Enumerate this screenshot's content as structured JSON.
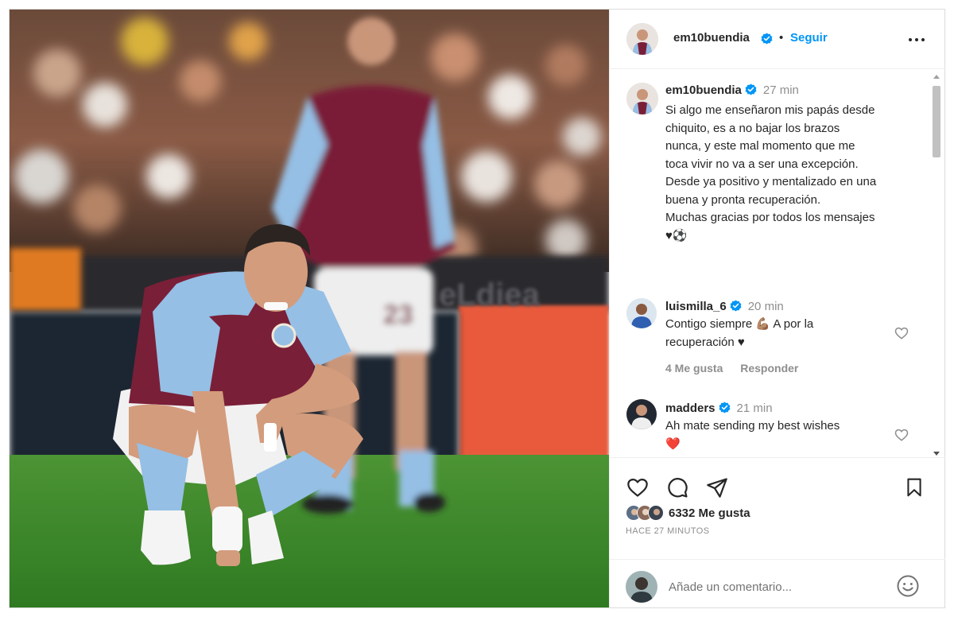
{
  "post": {
    "author": "em10buendia",
    "dot": "•",
    "follow_label": "Seguir",
    "more_icon": "more-horizontal-icon"
  },
  "caption": {
    "author": "em10buendia",
    "time": "27 min",
    "lines": [
      "Si algo me enseñaron mis papás desde",
      "chiquito, es a no bajar los brazos",
      "nunca, y este mal momento que me",
      "toca vivir no va a ser una excepción.",
      "Desde ya positivo y mentalizado en una",
      "buena y pronta recuperación.",
      "Muchas gracias por todos los mensajes",
      "♥⚽"
    ]
  },
  "comments": [
    {
      "user": "luismilla_6",
      "time": "20 min",
      "lines": [
        "Contigo siempre 💪🏽 A por la",
        "recuperación ♥"
      ],
      "likes": "4 Me gusta",
      "reply": "Responder"
    },
    {
      "user": "madders",
      "time": "21 min",
      "lines": [
        "Ah mate sending my best wishes",
        "❤️"
      ]
    }
  ],
  "footer": {
    "likes": "6332 Me gusta",
    "ago": "HACE 27 MINUTOS",
    "comment_placeholder": "Añade un comentario..."
  },
  "photo": {
    "shirt_number": "23"
  },
  "colors": {
    "accent": "#0095f6",
    "verified": "#0095f6",
    "heart_red": "#ed4956",
    "claret": "#7a1f38",
    "sky_blue": "#95bfe5",
    "pitch_green": "#3f8a2c"
  }
}
